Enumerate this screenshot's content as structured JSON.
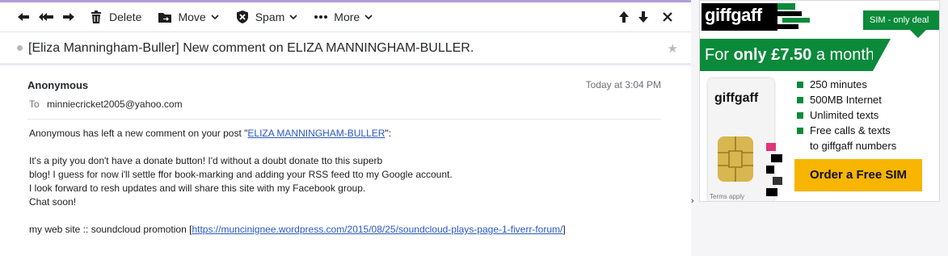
{
  "toolbar": {
    "delete_label": "Delete",
    "move_label": "Move",
    "spam_label": "Spam",
    "more_label": "More"
  },
  "message": {
    "subject": "[Eliza Manningham-Buller] New comment on ELIZA MANNINGHAM-BULLER.",
    "sender": "Anonymous",
    "time": "Today at 3:04 PM",
    "to_label": "To",
    "to_address": "minniecricket2005@yahoo.com",
    "body": {
      "intro_prefix": "Anonymous has left a new comment on your post \"",
      "intro_link": "ELIZA MANNINGHAM-BULLER",
      "intro_suffix": "\":",
      "line1": "It's a pity you don't have a donate button! I'd without a doubt donate tto this superb",
      "line2": "blog! I guess for now i'll settle ffor book-marking and adding your RSS feed tto my Google account.",
      "line3": "I look forward to resh updates and will share this site with my Facebook group.",
      "line4": "Chat soon!",
      "footer_prefix": "my web site :: soundcloud promotion [",
      "footer_link": "https://muncinignee.wordpress.com/2015/08/25/soundcloud-plays-page-1-fiverr-forum/",
      "footer_suffix": "]"
    }
  },
  "ad": {
    "brand": "giffgaff",
    "badge": "SIM - only deal",
    "offer_prefix": "For ",
    "offer_strong": "only £7.50",
    "offer_suffix": " a month:",
    "features": [
      "250 minutes",
      "500MB Internet",
      "Unlimited texts"
    ],
    "feature_last_line1": "Free calls & texts",
    "feature_last_line2": "to giffgaff numbers",
    "sim_brand": "giffgaff",
    "terms": "Terms apply",
    "cta": "Order a Free SIM",
    "colors": {
      "green": "#0b8a3a",
      "yellow": "#f7b500",
      "pink": "#e0337a",
      "black": "#000000"
    }
  },
  "side": {
    "collapse_arrow": "›"
  },
  "theme": {
    "accent": "#b39ddb",
    "link": "#2a58c2"
  }
}
